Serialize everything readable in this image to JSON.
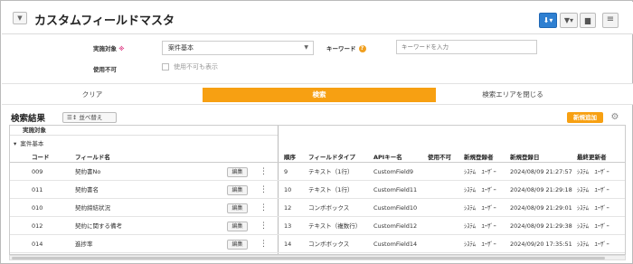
{
  "header": {
    "menu_icon": "chevron-down-icon",
    "title": "カスタムフィールドマスタ",
    "buttons": {
      "download_icon": "download-icon",
      "filter_icon": "filter-icon",
      "folder_icon": "folder-icon",
      "hamburger_icon": "hamburger-icon"
    },
    "accent_color": "#2e7fd1"
  },
  "search": {
    "target_label": "実施対象",
    "required_mark": "※",
    "target_value": "案件基本",
    "keyword_label": "キーワード",
    "keyword_placeholder": "キーワードを入力",
    "disabled_label": "使用不可",
    "show_disabled_label": "使用不可も表示"
  },
  "actions": {
    "clear": "クリア",
    "search": "検索",
    "close_area": "検索エリアを閉じる",
    "primary_color": "#f7a012"
  },
  "results": {
    "title": "検索結果",
    "sort_label": "並べ替え",
    "new_label": "新規追加",
    "group_header": "実施対象",
    "group_name": "案件基本",
    "columns": {
      "code": "コード",
      "field_name": "フィールド名",
      "order": "順序",
      "field_type": "フィールドタイプ",
      "api_key": "APIキー名",
      "disabled": "使用不可",
      "created_by": "新規登録者",
      "created_at": "新規登録日",
      "updated_by": "最終更新者"
    },
    "edit_label": "編集",
    "rows": [
      {
        "code": "009",
        "name": "契約書No",
        "order": "9",
        "type": "テキスト（1行）",
        "api": "CustomField9",
        "disabled": "",
        "creator": "ｼｽﾃﾑ　ﾕｰｻﾞｰ",
        "date": "2024/08/09 21:27:57",
        "updater": "ｼｽﾃﾑ　ﾕｰｻﾞｰ"
      },
      {
        "code": "011",
        "name": "契約書名",
        "order": "10",
        "type": "テキスト（1行）",
        "api": "CustomField11",
        "disabled": "",
        "creator": "ｼｽﾃﾑ　ﾕｰｻﾞｰ",
        "date": "2024/08/09 21:29:18",
        "updater": "ｼｽﾃﾑ　ﾕｰｻﾞｰ"
      },
      {
        "code": "010",
        "name": "契約締結状況",
        "order": "12",
        "type": "コンボボックス",
        "api": "CustomField10",
        "disabled": "",
        "creator": "ｼｽﾃﾑ　ﾕｰｻﾞｰ",
        "date": "2024/08/09 21:29:01",
        "updater": "ｼｽﾃﾑ　ﾕｰｻﾞｰ"
      },
      {
        "code": "012",
        "name": "契約に関する備考",
        "order": "13",
        "type": "テキスト（複数行）",
        "api": "CustomField12",
        "disabled": "",
        "creator": "ｼｽﾃﾑ　ﾕｰｻﾞｰ",
        "date": "2024/08/09 21:29:38",
        "updater": "ｼｽﾃﾑ　ﾕｰｻﾞｰ"
      },
      {
        "code": "014",
        "name": "進捗率",
        "order": "14",
        "type": "コンボボックス",
        "api": "CustomField14",
        "disabled": "",
        "creator": "ｼｽﾃﾑ　ﾕｰｻﾞｰ",
        "date": "2024/09/20 17:35:51",
        "updater": "ｼｽﾃﾑ　ﾕｰｻﾞｰ"
      }
    ]
  }
}
